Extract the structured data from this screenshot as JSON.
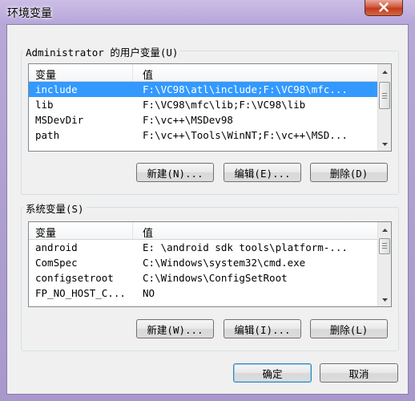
{
  "window": {
    "title": "环境变量",
    "close_icon": "close-icon"
  },
  "user_vars": {
    "group_label": "Administrator 的用户变量(U)",
    "col_name": "变量",
    "col_value": "值",
    "rows": [
      {
        "name": "include",
        "value": "F:\\VC98\\atl\\include;F:\\VC98\\mfc...",
        "selected": true
      },
      {
        "name": "lib",
        "value": "F:\\VC98\\mfc\\lib;F:\\VC98\\lib",
        "selected": false
      },
      {
        "name": "MSDevDir",
        "value": "F:\\vc++\\MSDev98",
        "selected": false
      },
      {
        "name": "path",
        "value": "F:\\vc++\\Tools\\WinNT;F:\\vc++\\MSD...",
        "selected": false
      }
    ],
    "new_label": "新建(N)...",
    "edit_label": "编辑(E)...",
    "delete_label": "删除(D)"
  },
  "system_vars": {
    "group_label": "系统变量(S)",
    "col_name": "变量",
    "col_value": "值",
    "rows": [
      {
        "name": "android",
        "value": "E: \\android sdk tools\\platform-...",
        "selected": false
      },
      {
        "name": "ComSpec",
        "value": "C:\\Windows\\system32\\cmd.exe",
        "selected": false
      },
      {
        "name": "configsetroot",
        "value": "C:\\Windows\\ConfigSetRoot",
        "selected": false
      },
      {
        "name": "FP_NO_HOST_C...",
        "value": "NO",
        "selected": false
      }
    ],
    "new_label": "新建(W)...",
    "edit_label": "编辑(I)...",
    "delete_label": "删除(L)"
  },
  "footer": {
    "ok_label": "确定",
    "cancel_label": "取消"
  },
  "colors": {
    "selection": "#3399ff",
    "title_gradient_top": "#cbbde6",
    "dialog_bg": "#f0f0f0"
  }
}
